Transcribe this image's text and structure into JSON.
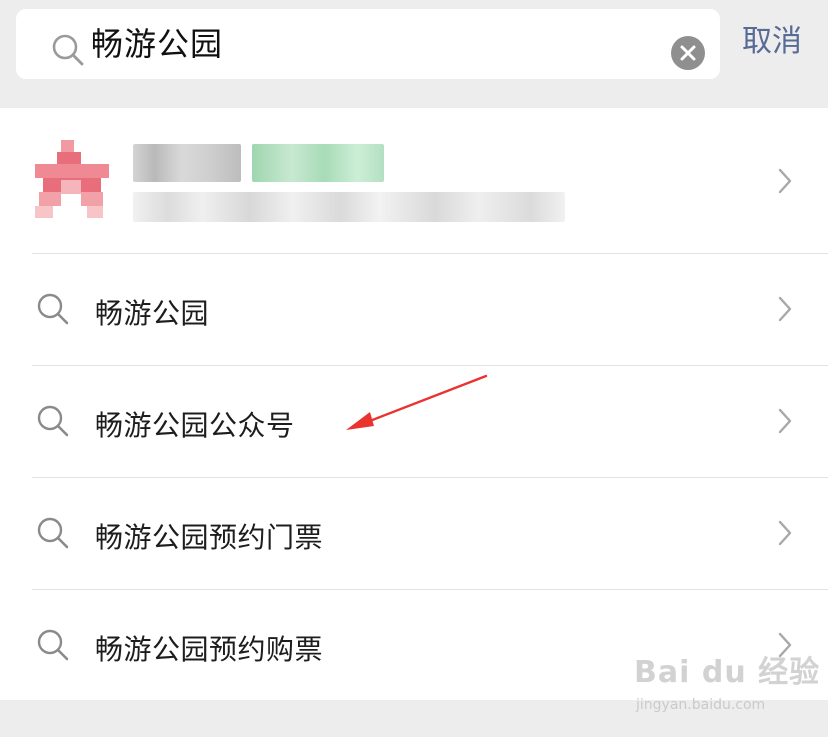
{
  "search": {
    "query": "畅游公园",
    "cancel_label": "取消"
  },
  "results": {
    "entity": {
      "icon": "star-logo-icon",
      "blurred": true
    },
    "suggestions": [
      {
        "label": "畅游公园",
        "icon": "search-icon"
      },
      {
        "label": "畅游公园公众号",
        "icon": "search-icon"
      },
      {
        "label": "畅游公园预约门票",
        "icon": "search-icon"
      },
      {
        "label": "畅游公园预约购票",
        "icon": "search-icon"
      }
    ]
  },
  "annotation": {
    "type": "red-arrow",
    "color": "#e8332f",
    "points_to": "畅游公园公众号"
  },
  "watermark": {
    "logo": "Bai du 经验",
    "subtitle": "jingyan.baidu.com"
  },
  "colors": {
    "accent_link": "#576b95",
    "background": "#ededed",
    "list_background": "#ffffff",
    "divider": "#e3e3e3",
    "icon_gray": "#8a8a8a"
  }
}
